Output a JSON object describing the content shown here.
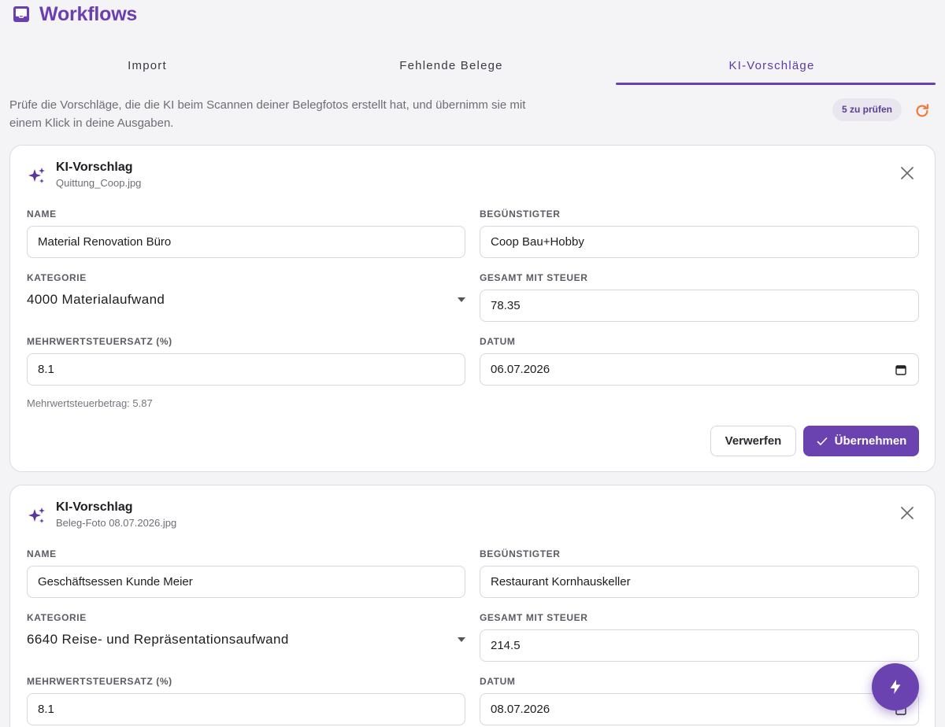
{
  "header": {
    "title": "Workflows",
    "icon": "inbox-icon"
  },
  "tabs": [
    {
      "label": "Import",
      "active": false
    },
    {
      "label": "Fehlende Belege",
      "active": false
    },
    {
      "label": "KI-Vorschläge",
      "active": true
    }
  ],
  "intro": "Prüfe die Vorschläge, die die KI beim Scannen deiner Belegfotos erstellt hat, und übernimm sie mit einem Klick in deine Ausgaben.",
  "badge": "5 zu prüfen",
  "labels": {
    "name": "NAME",
    "payee": "BEGÜNSTIGTER",
    "category": "KATEGORIE",
    "total": "GESAMT MIT STEUER",
    "vat_rate": "MEHRWERTSTEUERSATZ (%)",
    "date": "DATUM",
    "discard": "Verwerfen",
    "accept": "Übernehmen"
  },
  "suggestions": [
    {
      "title": "KI-Vorschlag",
      "file": "Quittung_Coop.jpg",
      "name": "Material Renovation Büro",
      "payee": "Coop Bau+Hobby",
      "category": "4000 Materialaufwand",
      "total": "78.35",
      "vat_rate": "8.1",
      "date": "06.07.2026",
      "vat_amount": "Mehrwertsteuerbetrag: 5.87"
    },
    {
      "title": "KI-Vorschlag",
      "file": "Beleg-Foto 08.07.2026.jpg",
      "name": "Geschäftsessen Kunde Meier",
      "payee": "Restaurant Kornhauskeller",
      "category": "6640 Reise- und Repräsentationsaufwand",
      "total": "214.5",
      "vat_rate": "8.1",
      "date": "08.07.2026"
    }
  ],
  "colors": {
    "accent": "#6a43b0",
    "refresh": "#f07a3a"
  }
}
